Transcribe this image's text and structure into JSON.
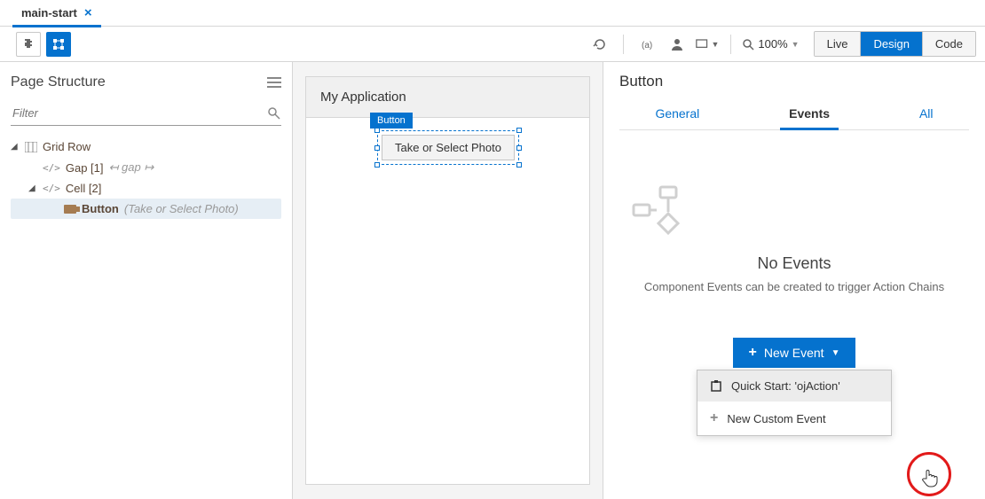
{
  "tabs": {
    "main": "main-start"
  },
  "toolbar": {
    "zoom": "100%",
    "mode_live": "Live",
    "mode_design": "Design",
    "mode_code": "Code"
  },
  "left": {
    "title": "Page Structure",
    "filter_placeholder": "Filter",
    "tree": {
      "grid_row": "Grid Row",
      "gap_label": "Gap [1]",
      "gap_hint": "↤ gap ↦",
      "cell_label": "Cell [2]",
      "button_label": "Button",
      "button_text": "(Take or Select Photo)"
    }
  },
  "canvas": {
    "app_title": "My Application",
    "component_tag": "Button",
    "button_text": "Take or Select Photo"
  },
  "right": {
    "title": "Button",
    "tab_general": "General",
    "tab_events": "Events",
    "tab_all": "All",
    "empty_title": "No Events",
    "empty_sub": "Component Events can be created to trigger Action Chains",
    "new_event": "New Event",
    "dd_quickstart": "Quick Start: 'ojAction'",
    "dd_custom": "New Custom Event"
  }
}
